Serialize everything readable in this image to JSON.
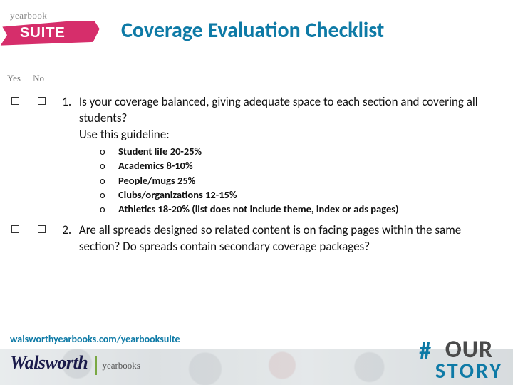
{
  "logo": {
    "top_word": "yearbook",
    "banner_word": "SUITE"
  },
  "title": "Coverage Evaluation Checklist",
  "columns": {
    "yes": "Yes",
    "no": "No"
  },
  "questions": [
    {
      "num": "1.",
      "text": "Is your coverage balanced, giving adequate space to each section and covering all students?\nUse this guideline:",
      "bullets": [
        "Student life 20-25%",
        "Academics 8-10%",
        "People/mugs 25%",
        "Clubs/organizations 12-15%",
        "Athletics 18-20% (list does not include theme, index or ads pages)"
      ]
    },
    {
      "num": "2.",
      "text": "Are all spreads designed so related content is on facing pages within the same section? Do spreads contain secondary coverage packages?"
    }
  ],
  "footer": {
    "url": "walsworthyearbooks.com/yearbooksuite",
    "brand_main": "Walsworth",
    "brand_sub": "yearbooks",
    "tag_hash": "#",
    "tag_our": "OUR",
    "tag_story": "STORY"
  },
  "colors": {
    "accent": "#0e7aa6",
    "banner": "#d62e6b"
  }
}
